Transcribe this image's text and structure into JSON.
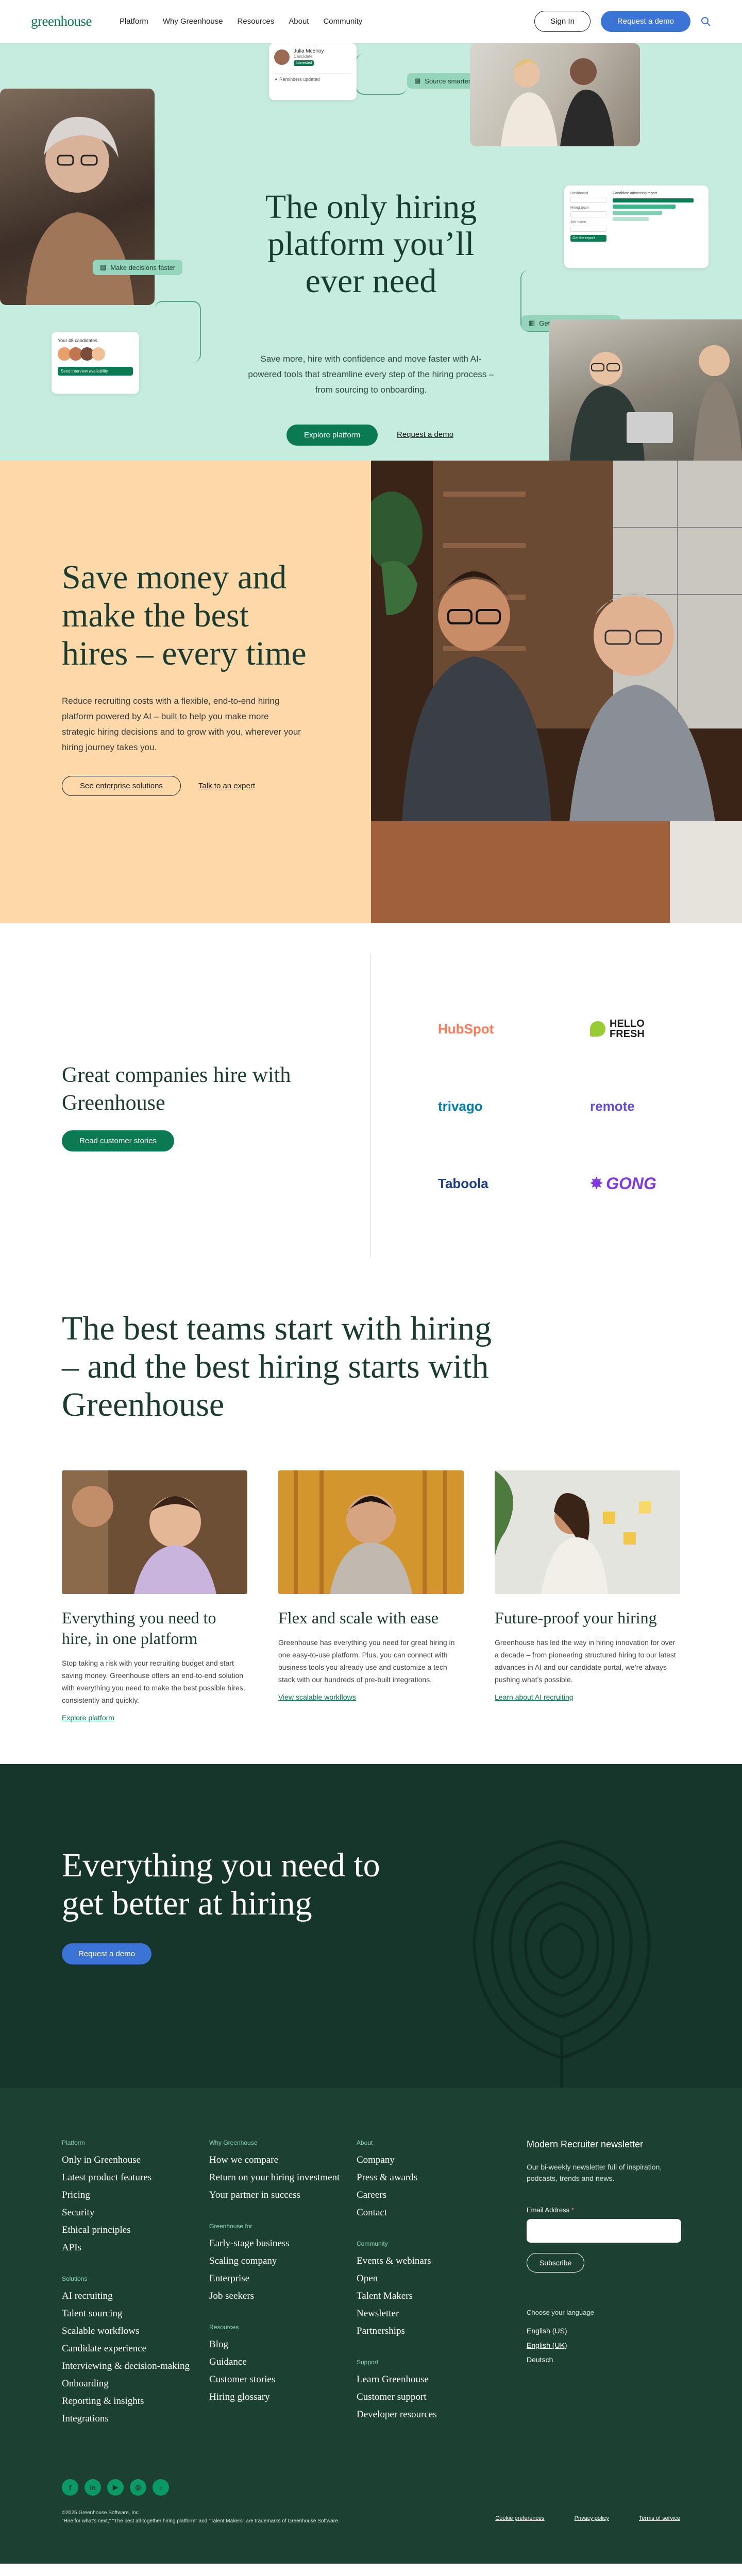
{
  "nav": {
    "logo": "greenhouse",
    "links": [
      "Platform",
      "Why Greenhouse",
      "Resources",
      "About",
      "Community"
    ],
    "sign_in": "Sign In",
    "request_demo": "Request a demo"
  },
  "hero": {
    "title": "The only hiring platform you’ll ever need",
    "subtitle": "Save more, hire with confidence and move faster with AI-powered tools that streamline every step of the hiring process – from sourcing to onboarding.",
    "primary_cta": "Explore platform",
    "secondary_cta": "Request a demo",
    "chip_decisions": "Make decisions faster",
    "chip_source": "Source smarter",
    "chip_insights": "Get data-backed insights",
    "card_candidate_name": "Julia Mcelroy",
    "card_candidate_role": "Candidate",
    "card_candidate_status": "Interested",
    "card_reminders": "Reminders updated",
    "card_candidates_label": "Your 48 candidates",
    "card_candidates_action": "Send interview availability",
    "card_report_labels": [
      "Dashboard",
      "Hiring team",
      "Job name"
    ],
    "card_report_title": "Candidate advancing report",
    "card_report_button": "Get the report"
  },
  "save": {
    "title": "Save money and make the best hires – every time",
    "body": "Reduce recruiting costs with a flexible, end-to-end hiring platform powered by AI – built to help you make more strategic hiring decisions and to grow with you, wherever your hiring journey takes you.",
    "primary_cta": "See enterprise solutions",
    "secondary_cta": "Talk to an expert"
  },
  "companies": {
    "title": "Great companies hire with Greenhouse",
    "cta": "Read customer stories",
    "logos": [
      "HubSpot",
      "HELLO FRESH",
      "trivago",
      "remote",
      "Taboola",
      "GONG"
    ],
    "logo_colors": [
      "#ff7a59",
      "#99cc33",
      "#007fad",
      "#624de3",
      "#1a3b88",
      "#8039df"
    ]
  },
  "teams": {
    "title": "The best teams start with hiring – and the best hiring starts with Greenhouse",
    "cards": [
      {
        "title": "Everything you need to hire, in one platform",
        "body": "Stop taking a risk with your recruiting budget and start saving money. Greenhouse offers an end-to-end solution with everything you need to make the best possible hires, consistently and quickly.",
        "link": "Explore platform"
      },
      {
        "title": "Flex and scale with ease",
        "body": "Greenhouse has everything you need for great hiring in one easy-to-use platform. Plus, you can connect with business tools you already use and customize a tech stack with our hundreds of pre-built integrations.",
        "link": "View scalable workflows"
      },
      {
        "title": "Future-proof your hiring",
        "body": "Greenhouse has led the way in hiring innovation for over a decade – from pioneering structured hiring to our latest advances in AI and our candidate portal, we’re always pushing what’s possible.",
        "link": "Learn about AI recruiting"
      }
    ]
  },
  "cta": {
    "title": "Everything you need to get better at hiring",
    "button": "Request a demo"
  },
  "footer": {
    "col1": [
      {
        "heading": "Platform",
        "items": [
          "Only in Greenhouse",
          "Latest product features",
          "Pricing",
          "Security",
          "Ethical principles",
          "APIs"
        ]
      },
      {
        "heading": "Solutions",
        "items": [
          "AI recruiting",
          "Talent sourcing",
          "Scalable workflows",
          "Candidate experience",
          "Interviewing & decision-making",
          "Onboarding",
          "Reporting & insights",
          "Integrations"
        ]
      }
    ],
    "col2": [
      {
        "heading": "Why Greenhouse",
        "items": [
          "How we compare",
          "Return on your hiring investment",
          "Your partner in success"
        ]
      },
      {
        "heading": "Greenhouse for",
        "items": [
          "Early-stage business",
          "Scaling company",
          "Enterprise",
          "Job seekers"
        ]
      },
      {
        "heading": "Resources",
        "items": [
          "Blog",
          "Guidance",
          "Customer stories",
          "Hiring glossary"
        ]
      }
    ],
    "col3": [
      {
        "heading": "About",
        "items": [
          "Company",
          "Press & awards",
          "Careers",
          "Contact"
        ]
      },
      {
        "heading": "Community",
        "items": [
          "Events & webinars",
          "Open",
          "Talent Makers",
          "Newsletter",
          "Partnerships"
        ]
      },
      {
        "heading": "Support",
        "items": [
          "Learn Greenhouse",
          "Customer support",
          "Developer resources"
        ]
      }
    ],
    "newsletter": {
      "title": "Modern Recruiter newsletter",
      "body": "Our bi-weekly newsletter full of inspiration, podcasts, trends and news.",
      "email_label": "Email Address",
      "subscribe": "Subscribe"
    },
    "language": {
      "heading": "Choose your language",
      "options": [
        "English (US)",
        "English (UK)",
        "Deutsch"
      ]
    },
    "social": [
      "f",
      "in",
      "▶",
      "◎",
      "♪"
    ],
    "copyright": "©2025 Greenhouse Software, Inc.",
    "trademark": "\"Hire for what's next,\" \"The best all-together hiring platform\" and \"Talent Makers\" are trademarks of Greenhouse Software.",
    "legal_links": [
      "Cookie preferences",
      "Privacy policy",
      "Terms of service"
    ]
  }
}
